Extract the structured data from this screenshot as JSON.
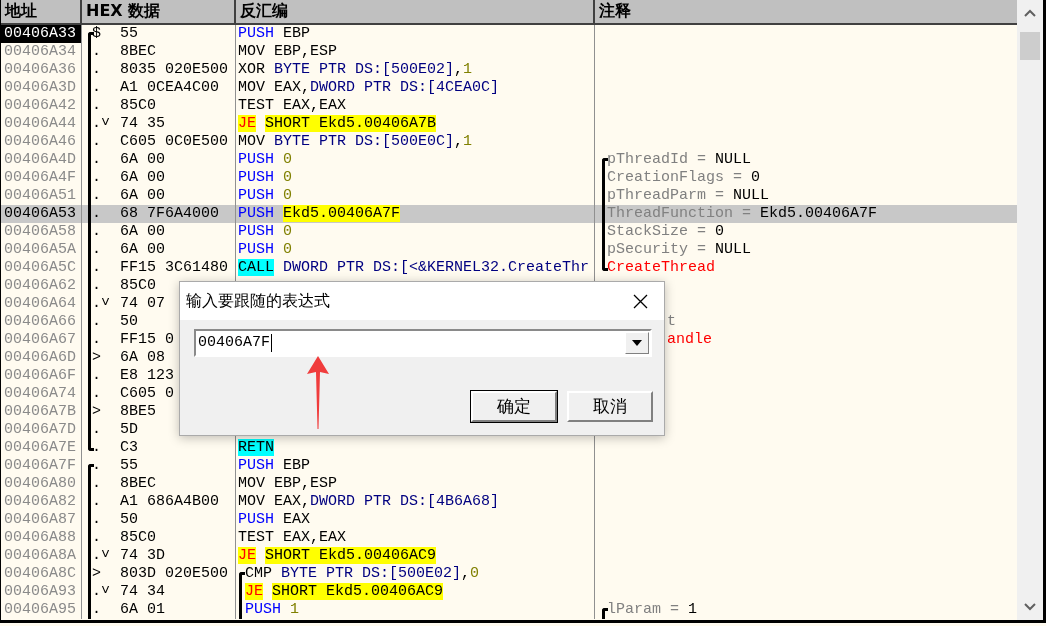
{
  "columns": [
    "地址",
    "HEX 数据",
    "反汇编",
    "注释"
  ],
  "rows": [
    {
      "address": "00406A33",
      "current": true,
      "selected": false,
      "block_start": true,
      "block_end": false,
      "marker": "$",
      "hex": "55",
      "code": [
        {
          "t": "PUSH",
          "kind": "push"
        },
        {
          "t": " EBP",
          "kind": "plain"
        }
      ]
    },
    {
      "address": "00406A34",
      "current": false,
      "selected": false,
      "block_start": false,
      "block_end": false,
      "marker": ".",
      "hex": "8BEC",
      "code": [
        {
          "t": "MOV EBP,ESP",
          "kind": "plain"
        }
      ]
    },
    {
      "address": "00406A36",
      "current": false,
      "selected": false,
      "block_start": false,
      "block_end": false,
      "marker": ".",
      "hex": "8035 020E500",
      "code": [
        {
          "t": "XOR",
          "kind": "plain"
        },
        {
          "t": " BYTE PTR DS:[500E02]",
          "kind": "ptr"
        },
        {
          "t": ",",
          "kind": "plain"
        },
        {
          "t": "1",
          "kind": "num"
        }
      ]
    },
    {
      "address": "00406A3D",
      "current": false,
      "selected": false,
      "block_start": false,
      "block_end": false,
      "marker": ".",
      "hex": "A1 0CEA4C00",
      "code": [
        {
          "t": "MOV EAX,",
          "kind": "plain"
        },
        {
          "t": "DWORD PTR DS:[4CEA0C]",
          "kind": "ptr"
        }
      ]
    },
    {
      "address": "00406A42",
      "current": false,
      "selected": false,
      "block_start": false,
      "block_end": false,
      "marker": ".",
      "hex": "85C0",
      "code": [
        {
          "t": "TEST EAX,EAX",
          "kind": "plain"
        }
      ]
    },
    {
      "address": "00406A44",
      "current": false,
      "selected": false,
      "block_start": false,
      "block_end": false,
      "marker": ".˅",
      "hex": "74 35",
      "code": [
        {
          "t": "JE",
          "kind": "jump"
        },
        {
          "t": " SHORT Ekd5.00406A7B",
          "kind": "target"
        }
      ]
    },
    {
      "address": "00406A46",
      "current": false,
      "selected": false,
      "block_start": false,
      "block_end": false,
      "marker": ".",
      "hex": "C605 0C0E500",
      "code": [
        {
          "t": "MOV",
          "kind": "plain"
        },
        {
          "t": " BYTE PTR DS:[500E0C]",
          "kind": "ptr"
        },
        {
          "t": ",",
          "kind": "plain"
        },
        {
          "t": "1",
          "kind": "num"
        }
      ]
    },
    {
      "address": "00406A4D",
      "current": false,
      "selected": false,
      "block_start": false,
      "block_end": false,
      "note_bracket_start": true,
      "marker": ".",
      "hex": "6A 00",
      "code": [
        {
          "t": "PUSH",
          "kind": "push"
        },
        {
          "t": " 0",
          "kind": "num"
        }
      ],
      "comment": [
        {
          "t": "pThreadId =",
          "kind": "arg"
        },
        {
          "t": " NULL",
          "kind": "value"
        }
      ]
    },
    {
      "address": "00406A4F",
      "current": false,
      "selected": false,
      "block_start": false,
      "block_end": false,
      "marker": ".",
      "hex": "6A 00",
      "code": [
        {
          "t": "PUSH",
          "kind": "push"
        },
        {
          "t": " 0",
          "kind": "num"
        }
      ],
      "comment": [
        {
          "t": "CreationFlags =",
          "kind": "arg"
        },
        {
          "t": " 0",
          "kind": "value"
        }
      ]
    },
    {
      "address": "00406A51",
      "current": false,
      "selected": false,
      "block_start": false,
      "block_end": false,
      "marker": ".",
      "hex": "6A 00",
      "code": [
        {
          "t": "PUSH",
          "kind": "push"
        },
        {
          "t": " 0",
          "kind": "num"
        }
      ],
      "comment": [
        {
          "t": "pThreadParm =",
          "kind": "arg"
        },
        {
          "t": " NULL",
          "kind": "value"
        }
      ]
    },
    {
      "address": "00406A53",
      "current": false,
      "selected": true,
      "block_start": false,
      "block_end": false,
      "marker": ".",
      "hex": "68 7F6A4000",
      "code": [
        {
          "t": "PUSH",
          "kind": "push"
        },
        {
          "t": " Ekd5.00406A7F",
          "kind": "target"
        }
      ],
      "comment": [
        {
          "t": "ThreadFunction =",
          "kind": "arg"
        },
        {
          "t": " Ekd5.00406A7F",
          "kind": "value"
        }
      ]
    },
    {
      "address": "00406A58",
      "current": false,
      "selected": false,
      "block_start": false,
      "block_end": false,
      "marker": ".",
      "hex": "6A 00",
      "code": [
        {
          "t": "PUSH",
          "kind": "push"
        },
        {
          "t": " 0",
          "kind": "num"
        }
      ],
      "comment": [
        {
          "t": "StackSize =",
          "kind": "arg"
        },
        {
          "t": " 0",
          "kind": "value"
        }
      ]
    },
    {
      "address": "00406A5A",
      "current": false,
      "selected": false,
      "block_start": false,
      "block_end": false,
      "marker": ".",
      "hex": "6A 00",
      "code": [
        {
          "t": "PUSH",
          "kind": "push"
        },
        {
          "t": " 0",
          "kind": "num"
        }
      ],
      "comment": [
        {
          "t": "pSecurity =",
          "kind": "arg"
        },
        {
          "t": " NULL",
          "kind": "value"
        }
      ]
    },
    {
      "address": "00406A5C",
      "current": false,
      "selected": false,
      "block_start": false,
      "block_end": false,
      "note_bracket_end": true,
      "marker": ".",
      "hex": "FF15 3C61480",
      "code": [
        {
          "t": "CALL",
          "kind": "call"
        },
        {
          "t": " DWORD PTR DS:[<&KERNEL32.CreateThr",
          "kind": "ptr"
        }
      ],
      "comment": [
        {
          "t": "CreateThread",
          "kind": "api"
        }
      ]
    },
    {
      "address": "00406A62",
      "current": false,
      "selected": false,
      "block_start": false,
      "block_end": false,
      "marker": ".",
      "hex": "85C0"
    },
    {
      "address": "00406A64",
      "current": false,
      "selected": false,
      "block_start": false,
      "block_end": false,
      "marker": ".˅",
      "hex": "74 07"
    },
    {
      "address": "00406A66",
      "current": false,
      "selected": false,
      "block_start": false,
      "block_end": false,
      "marker": ".",
      "hex": "50",
      "comment_cut": true,
      "comment": [
        {
          "t": "t",
          "kind": "arg"
        }
      ]
    },
    {
      "address": "00406A67",
      "current": false,
      "selected": false,
      "block_start": false,
      "block_end": false,
      "marker": ".",
      "hex": "FF15 0",
      "comment_cut": true,
      "comment": [
        {
          "t": "andle",
          "kind": "api"
        }
      ]
    },
    {
      "address": "00406A6D",
      "current": false,
      "selected": false,
      "block_start": false,
      "block_end": false,
      "marker": ">",
      "hex": "6A 08"
    },
    {
      "address": "00406A6F",
      "current": false,
      "selected": false,
      "block_start": false,
      "block_end": false,
      "marker": ".",
      "hex": "E8 123"
    },
    {
      "address": "00406A74",
      "current": false,
      "selected": false,
      "block_start": false,
      "block_end": false,
      "marker": ".",
      "hex": "C605 0"
    },
    {
      "address": "00406A7B",
      "current": false,
      "selected": false,
      "block_start": false,
      "block_end": false,
      "marker": ">",
      "hex": "8BE5"
    },
    {
      "address": "00406A7D",
      "current": false,
      "selected": false,
      "block_start": false,
      "block_end": false,
      "marker": ".",
      "hex": "5D"
    },
    {
      "address": "00406A7E",
      "current": false,
      "selected": false,
      "block_start": false,
      "block_end": true,
      "marker": ".",
      "hex": "C3",
      "code": [
        {
          "t": "RETN",
          "kind": "call"
        }
      ]
    },
    {
      "address": "00406A7F",
      "current": false,
      "selected": false,
      "block_start": true,
      "block_end": false,
      "marker": ".",
      "hex": "55",
      "code": [
        {
          "t": "PUSH",
          "kind": "push"
        },
        {
          "t": " EBP",
          "kind": "plain"
        }
      ]
    },
    {
      "address": "00406A80",
      "current": false,
      "selected": false,
      "block_start": false,
      "block_end": false,
      "marker": ".",
      "hex": "8BEC",
      "code": [
        {
          "t": "MOV EBP,ESP",
          "kind": "plain"
        }
      ]
    },
    {
      "address": "00406A82",
      "current": false,
      "selected": false,
      "block_start": false,
      "block_end": false,
      "marker": ".",
      "hex": "A1 686A4B00",
      "code": [
        {
          "t": "MOV EAX,",
          "kind": "plain"
        },
        {
          "t": "DWORD PTR DS:[4B6A68]",
          "kind": "ptr"
        }
      ]
    },
    {
      "address": "00406A87",
      "current": false,
      "selected": false,
      "block_start": false,
      "block_end": false,
      "marker": ".",
      "hex": "50",
      "code": [
        {
          "t": "PUSH",
          "kind": "push"
        },
        {
          "t": " EAX",
          "kind": "plain"
        }
      ]
    },
    {
      "address": "00406A88",
      "current": false,
      "selected": false,
      "block_start": false,
      "block_end": false,
      "marker": ".",
      "hex": "85C0",
      "code": [
        {
          "t": "TEST EAX,EAX",
          "kind": "plain"
        }
      ]
    },
    {
      "address": "00406A8A",
      "current": false,
      "selected": false,
      "block_start": false,
      "block_end": false,
      "marker": ".˅",
      "hex": "74 3D",
      "code": [
        {
          "t": "JE",
          "kind": "jump"
        },
        {
          "t": " SHORT Ekd5.00406AC9",
          "kind": "target"
        }
      ]
    },
    {
      "address": "00406A8C",
      "current": false,
      "selected": false,
      "block_start": false,
      "block_end": false,
      "code_bracket_start": true,
      "marker": ">",
      "hex": "803D 020E500",
      "code": [
        {
          "t": "CMP",
          "kind": "plain"
        },
        {
          "t": " BYTE PTR DS:[500E02]",
          "kind": "ptr"
        },
        {
          "t": ",",
          "kind": "plain"
        },
        {
          "t": "0",
          "kind": "num"
        }
      ]
    },
    {
      "address": "00406A93",
      "current": false,
      "selected": false,
      "block_start": false,
      "block_end": false,
      "marker": ".˅",
      "hex": "74 34",
      "code": [
        {
          "t": "JE",
          "kind": "jump"
        },
        {
          "t": " SHORT Ekd5.00406AC9",
          "kind": "target"
        }
      ]
    },
    {
      "address": "00406A95",
      "current": false,
      "selected": false,
      "block_start": false,
      "block_end": false,
      "note_bracket_start": true,
      "marker": ".",
      "hex": "6A 01",
      "code": [
        {
          "t": "PUSH",
          "kind": "push"
        },
        {
          "t": " 1",
          "kind": "num"
        }
      ],
      "comment": [
        {
          "t": "lParam =",
          "kind": "arg"
        },
        {
          "t": " 1",
          "kind": "value"
        }
      ]
    }
  ],
  "dialog": {
    "title": "输入要跟随的表达式",
    "value": "00406A7F",
    "buttons": [
      {
        "label": "确定",
        "default": true
      },
      {
        "label": "取消",
        "default": false
      }
    ]
  }
}
